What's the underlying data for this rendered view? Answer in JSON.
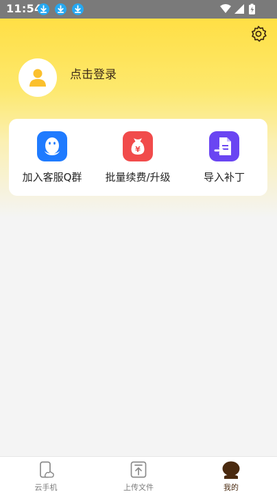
{
  "status_bar": {
    "time": "11:54",
    "notification_icons": [
      "download-icon",
      "download-icon",
      "download-icon"
    ],
    "system_icons": [
      "wifi-icon",
      "signal-icon",
      "battery-charging-icon"
    ]
  },
  "header": {
    "settings_icon": "gear-icon"
  },
  "profile": {
    "avatar_icon": "user-icon",
    "login_text": "点击登录"
  },
  "quick_actions": [
    {
      "label": "加入客服Q群",
      "icon": "qq-penguin-icon",
      "color": "#1f7bff"
    },
    {
      "label": "批量续费/升级",
      "icon": "money-bag-icon",
      "color": "#f14b4b"
    },
    {
      "label": "导入补丁",
      "icon": "import-file-icon",
      "color": "#6a45f2"
    }
  ],
  "tabs": [
    {
      "label": "云手机",
      "icon": "cloud-phone-icon",
      "active": false
    },
    {
      "label": "上传文件",
      "icon": "upload-file-icon",
      "active": false
    },
    {
      "label": "我的",
      "icon": "profile-icon",
      "active": true
    }
  ],
  "colors": {
    "header_yellow": "#ffdf45",
    "accent_brown": "#4a2a10",
    "avatar_yellow": "#fbc02d",
    "page_background": "#f4f4f4"
  }
}
